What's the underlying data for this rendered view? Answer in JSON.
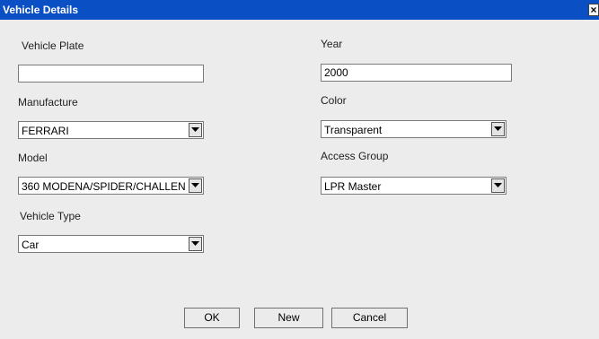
{
  "window": {
    "title": "Vehicle Details",
    "close_glyph": "×"
  },
  "fields": {
    "vehicle_plate": {
      "label": "Vehicle Plate",
      "value": ""
    },
    "year": {
      "label": "Year",
      "value": "2000"
    },
    "manufacture": {
      "label": "Manufacture",
      "value": "FERRARI"
    },
    "color": {
      "label": "Color",
      "value": "Transparent"
    },
    "model": {
      "label": "Model",
      "value": "360 MODENA/SPIDER/CHALLEN"
    },
    "access_group": {
      "label": "Access Group",
      "value": "LPR Master"
    },
    "vehicle_type": {
      "label": "Vehicle Type",
      "value": "Car"
    }
  },
  "buttons": {
    "ok": "OK",
    "new": "New",
    "cancel": "Cancel"
  },
  "colors": {
    "titlebar": "#0a4fc4",
    "dialog_bg": "#ececec"
  }
}
